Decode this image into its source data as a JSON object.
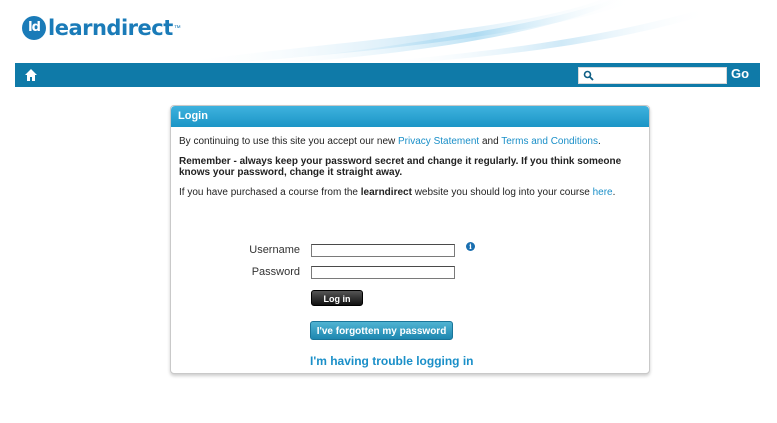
{
  "brand": {
    "logo_badge": "ld",
    "logo_text": "learndirect",
    "logo_mark": "™",
    "accent": "#1a7bb8",
    "nav_color": "#0f7aa8"
  },
  "navbar": {
    "home_icon": "home-icon",
    "search_icon": "search-icon",
    "search_value": "",
    "search_placeholder": "",
    "go_label": "Go"
  },
  "login": {
    "title": "Login",
    "privacy_prefix": "By continuing to use this site you accept our new ",
    "privacy_link": "Privacy Statement",
    "privacy_and": " and ",
    "terms_link": "Terms and Conditions",
    "privacy_suffix": ".",
    "remember_text": "Remember - always keep your password secret and change it regularly. If you think someone knows your password, change it straight away.",
    "course_prefix": "If you have purchased a course from the ",
    "course_brand": "learndirect",
    "course_middle": " website you should log into your course ",
    "course_link": "here",
    "course_suffix": ".",
    "username_label": "Username",
    "username_value": "",
    "password_label": "Password",
    "password_value": "",
    "info_glyph": "i",
    "login_button": "Log in",
    "forgot_button": "I've forgotten my password",
    "trouble_link": "I'm having trouble logging in"
  }
}
